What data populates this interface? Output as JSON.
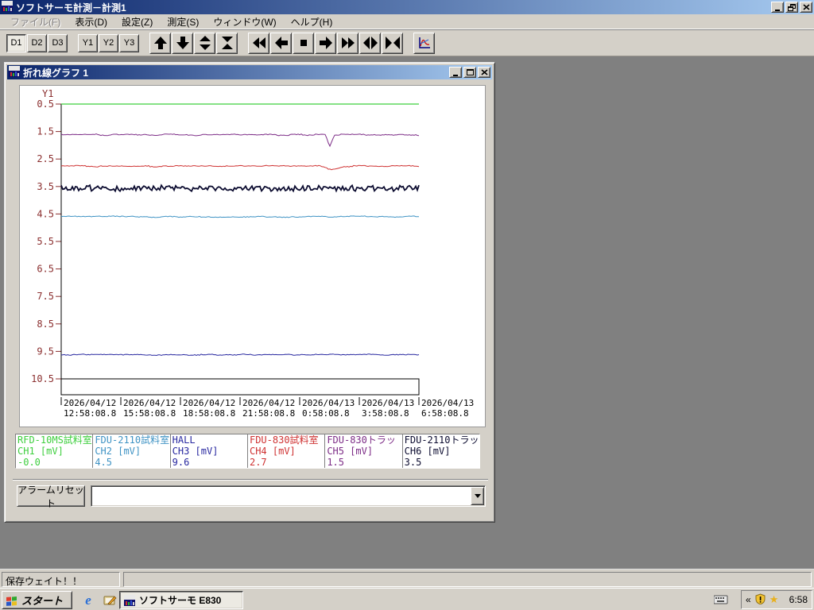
{
  "window": {
    "title": "ソフトサーモ計測－計測1",
    "controls": {
      "minimize": "minimize",
      "restore": "restore",
      "close": "close"
    }
  },
  "menu": {
    "items": [
      {
        "label": "ファイル(F)",
        "enabled": false
      },
      {
        "label": "表示(D)",
        "enabled": true
      },
      {
        "label": "設定(Z)",
        "enabled": true
      },
      {
        "label": "測定(S)",
        "enabled": true
      },
      {
        "label": "ウィンドウ(W)",
        "enabled": true
      },
      {
        "label": "ヘルプ(H)",
        "enabled": true
      }
    ]
  },
  "toolbar": {
    "buttons_d": [
      {
        "label": "D1",
        "pressed": true
      },
      {
        "label": "D2",
        "pressed": false
      },
      {
        "label": "D3",
        "pressed": false
      }
    ],
    "buttons_y": [
      {
        "label": "Y1",
        "pressed": false
      },
      {
        "label": "Y2",
        "pressed": false
      },
      {
        "label": "Y3",
        "pressed": false
      }
    ]
  },
  "graph_window": {
    "title": "折れ線グラフ 1"
  },
  "chart_data": {
    "type": "line",
    "title": "折れ線グラフ 1",
    "axis_label": "Y1",
    "axis_color": "#8b2f2f",
    "ylim_top": 0.5,
    "ylim_bottom": 10.5,
    "grid": false,
    "y_ticks": [
      "0.5",
      "1.5",
      "2.5",
      "3.5",
      "4.5",
      "5.5",
      "6.5",
      "7.5",
      "8.5",
      "9.5",
      "10.5"
    ],
    "x_ticks": [
      {
        "date": "2026/04/12",
        "time": "12:58:08.8"
      },
      {
        "date": "2026/04/12",
        "time": "15:58:08.8"
      },
      {
        "date": "2026/04/12",
        "time": "18:58:08.8"
      },
      {
        "date": "2026/04/12",
        "time": "21:58:08.8"
      },
      {
        "date": "2026/04/13",
        "time": "0:58:08.8"
      },
      {
        "date": "2026/04/13",
        "time": "3:58:08.8"
      },
      {
        "date": "2026/04/13",
        "time": "6:58:08.8"
      }
    ],
    "channels": [
      {
        "name": "RFD-10MS試料室",
        "ch_label": "CH1 [mV]",
        "value": "-0.0",
        "color": "#3ecf3e",
        "y_plot": 0.5,
        "amp": 0
      },
      {
        "name": "FDU-2110試料室",
        "ch_label": "CH2 [mV]",
        "value": "4.5",
        "color": "#3f93c4",
        "y_plot": 4.6,
        "amp": 0.9
      },
      {
        "name": "HALL",
        "ch_label": "CH3 [mV]",
        "value": "9.6",
        "color": "#2828a0",
        "y_plot": 9.62,
        "amp": 0.7
      },
      {
        "name": "FDU-830試料室",
        "ch_label": "CH4 [mV]",
        "value": "2.7",
        "color": "#cf3232",
        "y_plot": 2.76,
        "amp": 1.0,
        "spike": {
          "t": 0.756,
          "depth": 4,
          "width": 8
        }
      },
      {
        "name": "FDU-830トラッ",
        "ch_label": "CH5 [mV]",
        "value": "1.5",
        "color": "#7d2d87",
        "y_plot": 1.62,
        "amp": 1.1,
        "spike": {
          "t": 0.751,
          "depth": 14,
          "width": 3
        }
      },
      {
        "name": "FDU-2110トラッ",
        "ch_label": "CH6 [mV]",
        "value": "3.5",
        "color": "#0c0c30",
        "y_plot": 3.58,
        "amp": 3.2,
        "dense": true
      }
    ]
  },
  "alarm": {
    "reset_label": "アラームリセット",
    "combo_value": ""
  },
  "status_bar": {
    "message": "保存ウェイト！！"
  },
  "taskbar": {
    "start_label": "スタート",
    "task_button_label": "ソフトサーモ  E830",
    "tray_chevron": "«",
    "clock": "6:58"
  }
}
